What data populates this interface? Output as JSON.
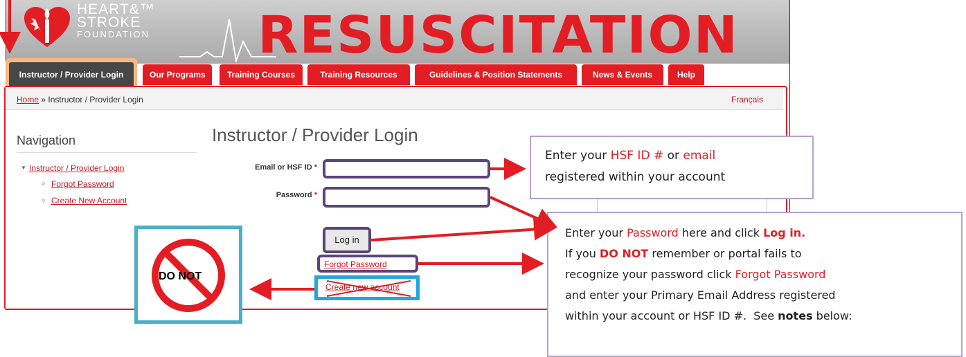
{
  "header": {
    "logo_line1": "HEART&™",
    "logo_line2": "STROKE",
    "logo_line3": "FOUNDATION",
    "site_title": "RESUSCITATION"
  },
  "tabs": [
    {
      "label": "Instructor / Provider Login",
      "active": true
    },
    {
      "label": "Our Programs"
    },
    {
      "label": "Training Courses"
    },
    {
      "label": "Training Resources"
    },
    {
      "label": "Guidelines & Position Statements"
    },
    {
      "label": "News & Events"
    },
    {
      "label": "Help"
    }
  ],
  "breadcrumb": {
    "home": "Home",
    "separator": " » ",
    "current": "Instructor / Provider Login"
  },
  "language_link": "Français",
  "navigation": {
    "heading": "Navigation",
    "items": [
      {
        "label": "Instructor / Provider Login"
      },
      {
        "label": "Forgot Password"
      },
      {
        "label": "Create New Account"
      }
    ]
  },
  "form": {
    "title": "Instructor / Provider Login",
    "email_label": "Email or HSF ID",
    "password_label": "Password",
    "required_mark": "*",
    "email_value": "",
    "password_value": "",
    "login_button": "Log in",
    "forgot_link": "Forgot Password",
    "create_link": "Create new account"
  },
  "callouts": {
    "c1": {
      "p1": "Enter your ",
      "hsf": "HSF ID #",
      "p2": " or ",
      "email": "email",
      "p3": "registered within your account"
    },
    "c2": {
      "l1a": "Enter your ",
      "l1b": "Password",
      "l1c": " here and click ",
      "l1d": "Log in.",
      "l2a": "If you ",
      "l2b": "DO NOT",
      "l2c": " remember or portal fails to",
      "l3a": "recognize your password click ",
      "l3b": "Forgot Password",
      "l4": "and enter your Primary Email Address registered",
      "l5a": "within your account or HSF ID #.  See ",
      "l5b": "notes",
      "l5c": " below:"
    }
  },
  "donot_sign": "DO NOT",
  "colors": {
    "brand_red": "#e31d24",
    "annotation_purple": "#5a4676",
    "annotation_blue": "#22a7dd",
    "highlight_orange": "#f5b886"
  }
}
